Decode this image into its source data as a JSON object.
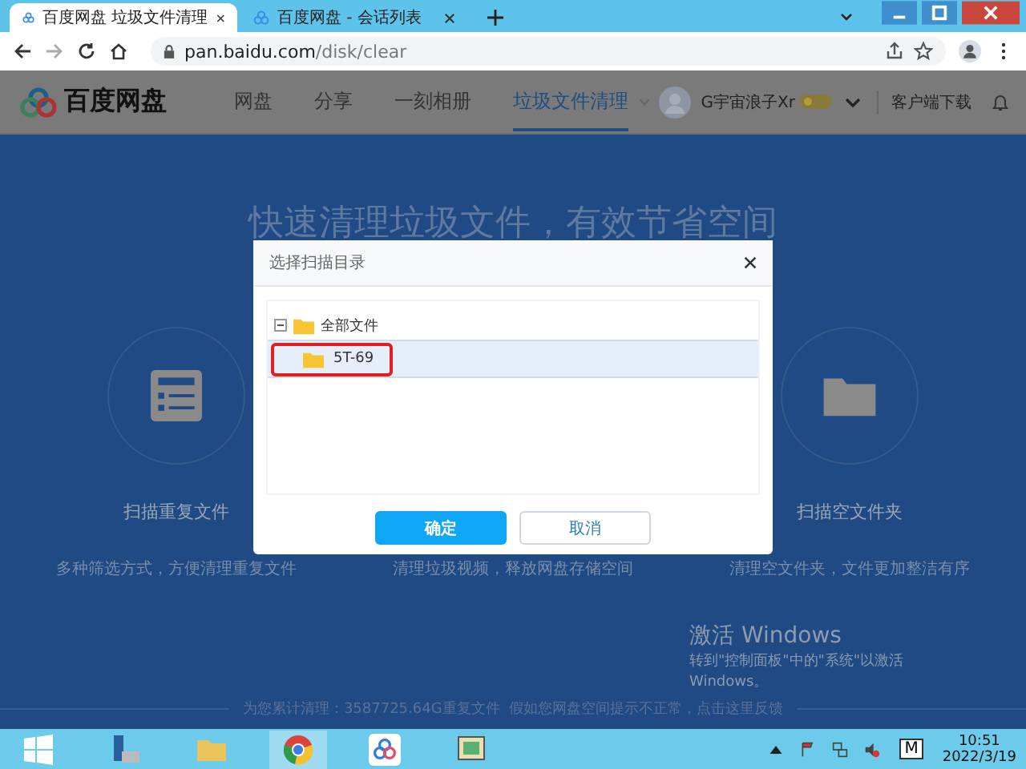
{
  "browser": {
    "tabs": [
      {
        "title": "百度网盘 垃圾文件清理",
        "selected": true
      },
      {
        "title": "百度网盘 - 会话列表",
        "selected": false
      }
    ],
    "url_host": "pan.baidu.com",
    "url_path": "/disk/clear"
  },
  "site": {
    "logo": "百度网盘",
    "nav": [
      {
        "label": "网盘",
        "selected": false
      },
      {
        "label": "分享",
        "selected": false
      },
      {
        "label": "一刻相册",
        "selected": false
      },
      {
        "label": "垃圾文件清理",
        "selected": true
      }
    ],
    "user": "G宇宙浪子Xr",
    "download": "客户端下载"
  },
  "page": {
    "heading": "快速清理垃圾文件，有效节省空间",
    "features": [
      {
        "kind": "list",
        "title": "扫描重复文件",
        "desc": "多种筛选方式，方便清理重复文件"
      },
      {
        "kind": "video",
        "desc": "清理垃圾视频，释放网盘存储空间"
      },
      {
        "kind": "folder",
        "title": "扫描空文件夹",
        "desc": "清理空文件夹，文件更加整洁有序"
      }
    ],
    "footer": "为您累计清理：3587725.64G重复文件  假如您网盘空间提示不正常，点击这里反馈"
  },
  "dialog": {
    "title": "选择扫描目录",
    "tree": [
      {
        "label": "全部文件",
        "expanded": true,
        "selected": false,
        "children": [
          {
            "label": "5T-69",
            "selected": true
          }
        ]
      }
    ],
    "ok": "确定",
    "cancel": "取消"
  },
  "activation": {
    "title": "激活 Windows",
    "text": "转到\"控制面板\"中的\"系统\"以激活",
    "text2": "Windows。"
  },
  "taskbar": {
    "time": "10:51",
    "date": "2022/3/19",
    "ime": "M"
  }
}
